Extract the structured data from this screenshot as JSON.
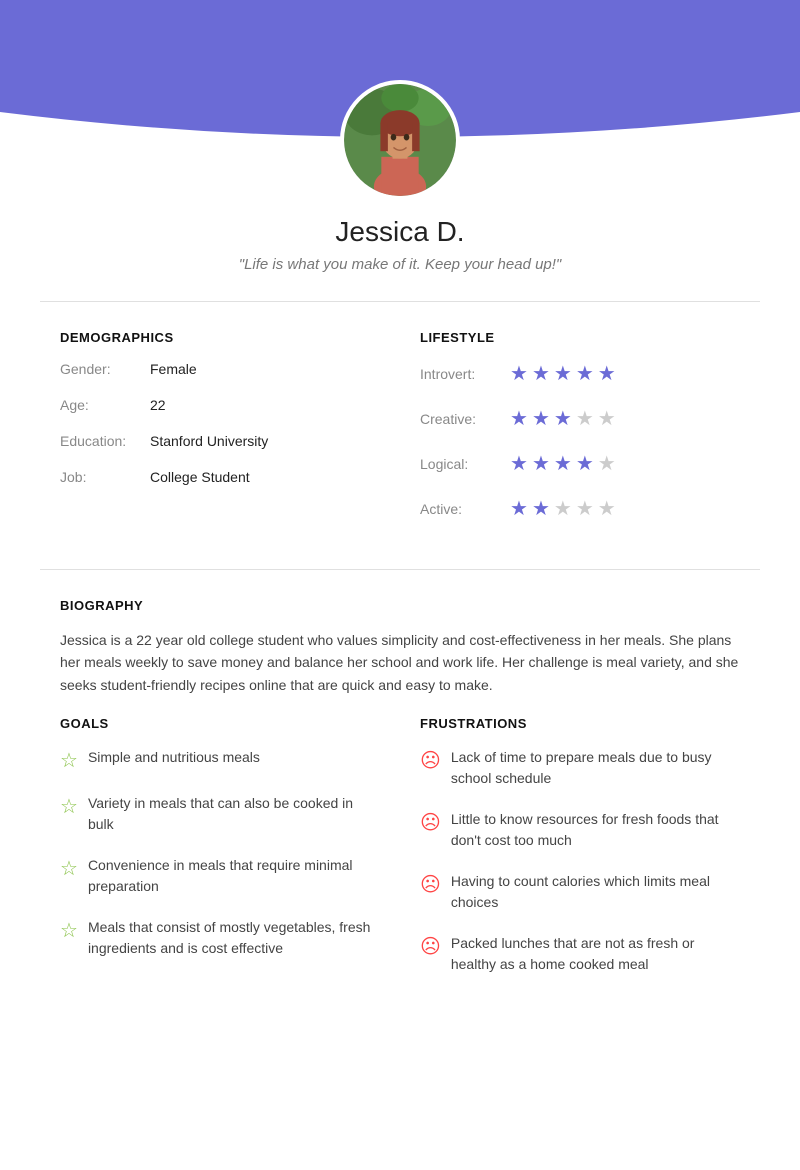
{
  "header": {
    "bg_color": "#6B6BD6"
  },
  "profile": {
    "name": "Jessica D.",
    "quote": "\"Life is what you make of it. Keep your head up!\""
  },
  "demographics": {
    "title": "DEMOGRAPHICS",
    "rows": [
      {
        "label": "Gender:",
        "value": "Female"
      },
      {
        "label": "Age:",
        "value": "22"
      },
      {
        "label": "Education:",
        "value": "Stanford University"
      },
      {
        "label": "Job:",
        "value": "College Student"
      }
    ]
  },
  "lifestyle": {
    "title": "LIFESTYLE",
    "rows": [
      {
        "label": "Introvert:",
        "filled": 5,
        "total": 5
      },
      {
        "label": "Creative:",
        "filled": 3,
        "total": 5
      },
      {
        "label": "Logical:",
        "filled": 4,
        "total": 5
      },
      {
        "label": "Active:",
        "filled": 2,
        "total": 5
      }
    ]
  },
  "biography": {
    "title": "BIOGRAPHY",
    "text": "Jessica is a 22 year old college student who values simplicity and cost-effectiveness in her meals. She plans her meals weekly to save money and balance her school and work life. Her challenge is meal variety, and she seeks student-friendly recipes online that are quick and easy to make."
  },
  "goals": {
    "title": "GOALS",
    "items": [
      "Simple and nutritious meals",
      "Variety in meals that can also be cooked in bulk",
      "Convenience in meals that require minimal preparation",
      "Meals that consist of mostly vegetables, fresh ingredients and is cost effective"
    ]
  },
  "frustrations": {
    "title": "FRUSTRATIONS",
    "items": [
      "Lack of time to prepare meals due to busy school schedule",
      "Little to know resources for fresh foods that don't cost too much",
      "Having to count calories which limits meal choices",
      "Packed lunches that are not as fresh or healthy as a home cooked meal"
    ]
  }
}
